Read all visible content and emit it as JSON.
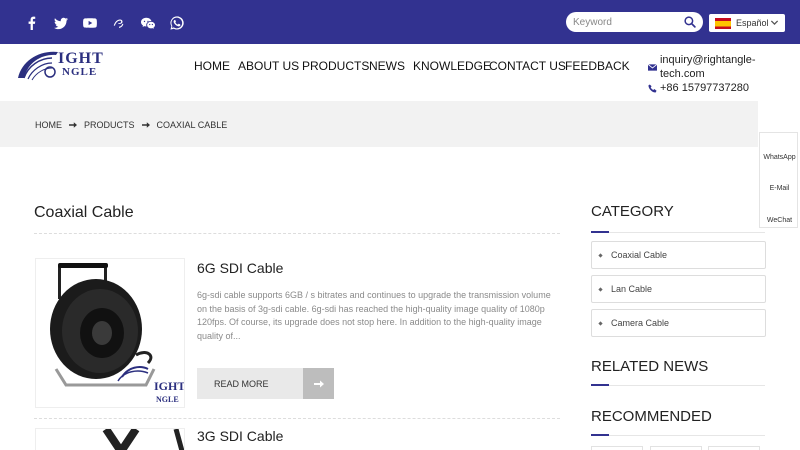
{
  "header": {
    "social": [
      "facebook-icon",
      "twitter-icon",
      "youtube-icon",
      "link-icon",
      "wechat-icon",
      "whatsapp-icon"
    ],
    "search_placeholder": "Keyword",
    "language": "Español",
    "logo_line1": "IGHT",
    "logo_line2": "NGLE",
    "nav": [
      "HOME",
      "ABOUT US",
      "PRODUCTS",
      "NEWS",
      "KNOWLEDGE",
      "CONTACT US",
      "FEEDBACK"
    ],
    "email": "inquiry@rightangle-tech.com",
    "phone": "+86 15797737280",
    "brand_color": "#323290"
  },
  "breadcrumb": [
    "HOME",
    "PRODUCTS",
    "COAXIAL CABLE"
  ],
  "float_bar": [
    "WhatsApp",
    "E-Mail",
    "WeChat"
  ],
  "main": {
    "title": "Coaxial Cable",
    "products": [
      {
        "name": "6G SDI Cable",
        "description": "6g-sdi cable supports 6GB / s bitrates and continues to upgrade the transmission volume on the basis of 3g-sdi cable. 6g-sdi has reached the high-quality image quality of 1080p 120fps. Of course, its upgrade does not stop here. In addition to the high-quality image quality of...",
        "button": "READ MORE",
        "thumb_logo1": "IGHT",
        "thumb_logo2": "NGLE"
      },
      {
        "name": "3G SDI Cable"
      }
    ]
  },
  "sidebar": {
    "category_title": "CATEGORY",
    "categories": [
      "Coaxial Cable",
      "Lan Cable",
      "Camera Cable"
    ],
    "related_title": "RELATED NEWS",
    "recommended_title": "RECOMMENDED"
  }
}
